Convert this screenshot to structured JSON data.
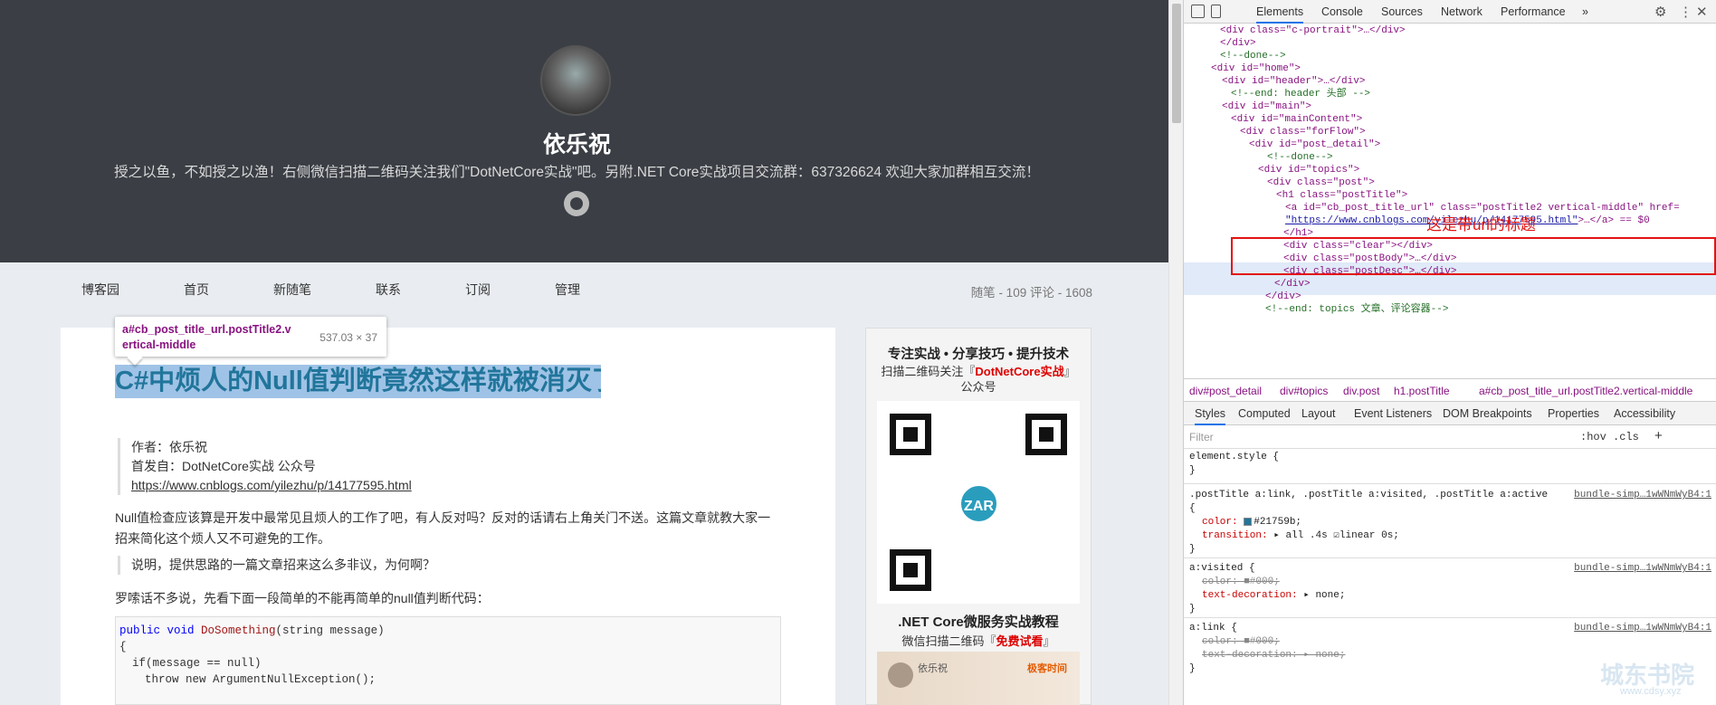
{
  "blog": {
    "author_name": "依乐祝",
    "intro": "授之以鱼，不如授之以渔！右侧微信扫描二维码关注我们\"DotNetCore实战\"吧。另附.NET Core实战项目交流群：637326624 欢迎大家加群相互交流！",
    "nav": [
      "博客园",
      "首页",
      "新随笔",
      "联系",
      "订阅",
      "管理"
    ],
    "stats": "随笔 - 109  评论 - 1608",
    "tooltip_selector": "a#cb_post_title_url.postTitle2.vertical-middle",
    "tooltip_dims": "537.03 × 37",
    "post_title": "C#中烦人的Null值判断竟然这样就被消灭了",
    "meta_author": "作者：依乐祝",
    "meta_first": "首发自：DotNetCore实战 公众号",
    "meta_link": "https://www.cnblogs.com/yilezhu/p/14177595.html",
    "para1": "Null值检查应该算是开发中最常见且烦人的工作了吧，有人反对吗？反对的话请右上角关门不送。这篇文章就教大家一招来简化这个烦人又不可避免的工作。",
    "note": "说明，提供思路的一篇文章招来这么多非议，为何啊？",
    "para2": "罗嗦话不多说，先看下面一段简单的不能再简单的null值判断代码：",
    "code": {
      "line1_kw": "public void",
      "line1_fn": "DoSomething",
      "line1_args": "(string message)",
      "line2": "{",
      "line3": "if(message == null)",
      "line4": "throw new ArgumentNullException();"
    }
  },
  "sidebar": {
    "heading": "专注实战 • 分享技巧 • 提升技术",
    "sub_pre": "扫描二维码关注『",
    "sub_brand": "DotNetCore实战",
    "sub_post": "』公众号",
    "qr_badge": "ZAR",
    "course_title": ".NET Core微服务实战教程",
    "course_pre": "微信扫描二维码『",
    "course_free": "免费试看",
    "course_post": "』",
    "banner_name": "依乐祝",
    "banner_brand": "极客时间"
  },
  "devtools": {
    "tabs": [
      "Elements",
      "Console",
      "Sources",
      "Network",
      "Performance",
      "»"
    ],
    "annotation": "这是带url的标题",
    "breadcrumbs": [
      "div#post_detail",
      "div#topics",
      "div.post",
      "h1.postTitle",
      "a#cb_post_title_url.postTitle2.vertical-middle"
    ],
    "style_tabs": [
      "Styles",
      "Computed",
      "Layout",
      "Event Listeners",
      "DOM Breakpoints",
      "Properties",
      "Accessibility"
    ],
    "filter_placeholder": "Filter",
    "filter_hov": ":hov  .cls",
    "tree": {
      "l1": "<div class=\"c-portrait\">…</div>",
      "l2": "</div>",
      "l3": "<!--done-->",
      "l4": "<div id=\"home\">",
      "l5": "<div id=\"header\">…</div>",
      "l6": "<!--end: header 头部 -->",
      "l7": "<div id=\"main\">",
      "l8": "<div id=\"mainContent\">",
      "l9": "<div class=\"forFlow\">",
      "l10": "<div id=\"post_detail\">",
      "l11": "<!--done-->",
      "l12": "<div id=\"topics\">",
      "l13": "<div class=\"post\">",
      "l14": "<h1 class=\"postTitle\">",
      "l15": "<a id=\"cb_post_title_url\" class=\"postTitle2 vertical-middle\" href=",
      "l16a": "\"https://www.cnblogs.com/yilezhu/p/14177595.html\"",
      "l16b": ">…</a> == $0",
      "l17": "</h1>",
      "l18": "<div class=\"clear\"></div>",
      "l19": "<div class=\"postBody\">…</div>",
      "l20": "<div class=\"postDesc\">…</div>",
      "l21": "</div>",
      "l22": "</div>",
      "l23": "<!--end: topics 文章、评论容器-->"
    },
    "rules": {
      "r0": "element.style {",
      "r0e": "}",
      "r1sel": ".postTitle a:link, .postTitle a:visited, .postTitle a:active",
      "r1src": "bundle-simp…1wWNmWyB4:1",
      "r1open": "{",
      "r1p1": "color:",
      "r1v1": "#21759b;",
      "r1p2": "transition:",
      "r1v2": "▸ all .4s ☑linear 0s;",
      "r1e": "}",
      "r2sel": "a:visited {",
      "r2src": "bundle-simp…1wWNmWyB4:1",
      "r2p1": "color: ■#000;",
      "r2p2": "text-decoration:",
      "r2v2": "▸ none;",
      "r2e": "}",
      "r3sel": "a:link {",
      "r3src": "bundle-simp…1wWNmWyB4:1",
      "r3p1": "color: ■#000;",
      "r3p2": "text-decoration: ▸ none;",
      "r3e": "}"
    },
    "colors": {
      "accent": "#1a73e8",
      "tag": "#881280",
      "attr_name": "#994500",
      "attr_value": "#1a1aa6",
      "annotation": "#e41313"
    }
  },
  "watermark": "城东书院",
  "watermark_url": "www.cdsy.xyz"
}
